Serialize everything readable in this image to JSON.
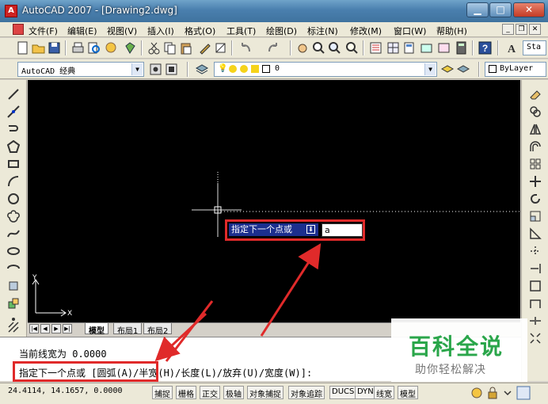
{
  "window": {
    "title": "AutoCAD 2007 - [Drawing2.dwg]"
  },
  "menu": [
    "文件(F)",
    "编辑(E)",
    "视图(V)",
    "插入(I)",
    "格式(O)",
    "工具(T)",
    "绘图(D)",
    "标注(N)",
    "修改(M)",
    "窗口(W)",
    "帮助(H)"
  ],
  "toolbar": {
    "workspace": "AutoCAD 经典",
    "layer": "0",
    "linetype": "ByLayer",
    "style_text": "Sta"
  },
  "dynamic_input": {
    "prompt": "指定下一个点或",
    "value": "a"
  },
  "tabs": [
    "模型",
    "布局1",
    "布局2"
  ],
  "ucs": {
    "x": "X",
    "y": "Y"
  },
  "command": {
    "line1": "当前线宽为 0.0000",
    "line2": "指定下一个点或 [圆弧(A)/半宽(H)/长度(L)/放弃(U)/宽度(W)]:"
  },
  "status": {
    "coords": "24.4114, 14.1657, 0.0000",
    "buttons": [
      "捕捉",
      "栅格",
      "正交",
      "极轴",
      "对象捕捉",
      "对象追踪",
      "DUCS",
      "DYN",
      "线宽",
      "模型"
    ]
  },
  "watermark": {
    "title": "百科全说",
    "subtitle": "助你轻松解决"
  },
  "colors": {
    "highlight_box": "#e02a2a",
    "canvas": "#000000",
    "dyn_prompt_bg": "#1c2f8e"
  }
}
